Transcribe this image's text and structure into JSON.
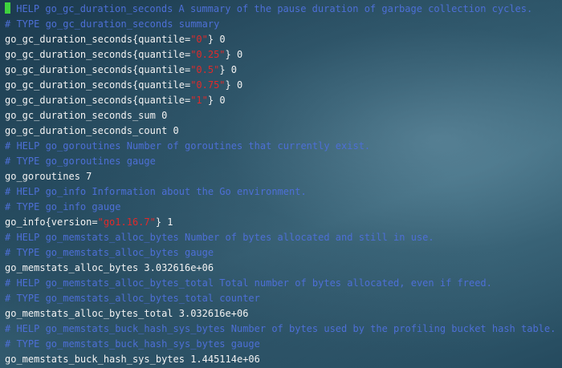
{
  "terminal": {
    "lines": [
      {
        "kind": "comment",
        "cursor": true,
        "text": " HELP go_gc_duration_seconds A summary of the pause duration of garbage collection cycles."
      },
      {
        "kind": "comment",
        "text": "# TYPE go_gc_duration_seconds summary"
      },
      {
        "kind": "metric",
        "pre": "go_gc_duration_seconds{quantile=",
        "str": "\"0\"",
        "post": "} 0"
      },
      {
        "kind": "metric",
        "pre": "go_gc_duration_seconds{quantile=",
        "str": "\"0.25\"",
        "post": "} 0"
      },
      {
        "kind": "metric",
        "pre": "go_gc_duration_seconds{quantile=",
        "str": "\"0.5\"",
        "post": "} 0"
      },
      {
        "kind": "metric",
        "pre": "go_gc_duration_seconds{quantile=",
        "str": "\"0.75\"",
        "post": "} 0"
      },
      {
        "kind": "metric",
        "pre": "go_gc_duration_seconds{quantile=",
        "str": "\"1\"",
        "post": "} 0"
      },
      {
        "kind": "metric",
        "pre": "go_gc_duration_seconds_sum 0"
      },
      {
        "kind": "metric",
        "pre": "go_gc_duration_seconds_count 0"
      },
      {
        "kind": "comment",
        "text": "# HELP go_goroutines Number of goroutines that currently exist."
      },
      {
        "kind": "comment",
        "text": "# TYPE go_goroutines gauge"
      },
      {
        "kind": "metric",
        "pre": "go_goroutines 7"
      },
      {
        "kind": "comment",
        "text": "# HELP go_info Information about the Go environment."
      },
      {
        "kind": "comment",
        "text": "# TYPE go_info gauge"
      },
      {
        "kind": "metric",
        "pre": "go_info{version=",
        "str": "\"go1.16.7\"",
        "post": "} 1"
      },
      {
        "kind": "comment",
        "text": "# HELP go_memstats_alloc_bytes Number of bytes allocated and still in use."
      },
      {
        "kind": "comment",
        "text": "# TYPE go_memstats_alloc_bytes gauge"
      },
      {
        "kind": "metric",
        "pre": "go_memstats_alloc_bytes 3.032616e+06"
      },
      {
        "kind": "comment",
        "text": "# HELP go_memstats_alloc_bytes_total Total number of bytes allocated, even if freed."
      },
      {
        "kind": "comment",
        "text": "# TYPE go_memstats_alloc_bytes_total counter"
      },
      {
        "kind": "metric",
        "pre": "go_memstats_alloc_bytes_total 3.032616e+06"
      },
      {
        "kind": "comment",
        "text": "# HELP go_memstats_buck_hash_sys_bytes Number of bytes used by the profiling bucket hash table."
      },
      {
        "kind": "comment",
        "text": "# TYPE go_memstats_buck_hash_sys_bytes gauge"
      },
      {
        "kind": "metric",
        "pre": "go_memstats_buck_hash_sys_bytes 1.445114e+06"
      }
    ]
  },
  "colors": {
    "comment": "#4d6fd6",
    "metric": "#f2f2f2",
    "string": "#e02a2a",
    "cursor": "#3ed23e"
  }
}
